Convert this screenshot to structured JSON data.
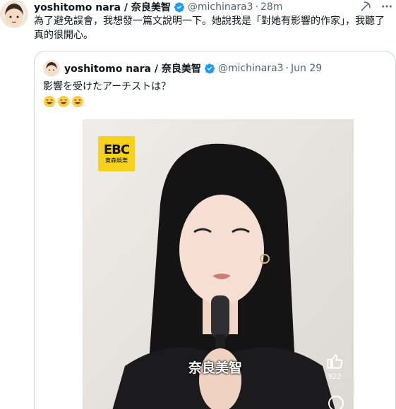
{
  "author": {
    "display_name": "yoshitomo nara / 奈良美智",
    "handle": "@michinara3",
    "time": "28m"
  },
  "tweet_text": "為了避免誤會，我想發一篇文說明一下。她說我是「對她有影響的作家」，我聽了真的很開心。",
  "quoted": {
    "display_name": "yoshitomo nara / 奈良美智",
    "handle": "@michinara3",
    "date": "Jun 29",
    "text": "影響を受けたアーチストは？",
    "media": {
      "logo_text": "EBC",
      "logo_sub": "東森娛樂",
      "caption": "奈良美智",
      "like_count": "922"
    }
  },
  "icons": [
    "verified-badge",
    "grok-icon",
    "more-icon",
    "grinning-emoji",
    "thumbs-up-icon"
  ],
  "colors": {
    "verified": "#1d9bf0",
    "muted": "#536471",
    "border": "#cfd9de",
    "logo_bg": "#f6d21c"
  }
}
